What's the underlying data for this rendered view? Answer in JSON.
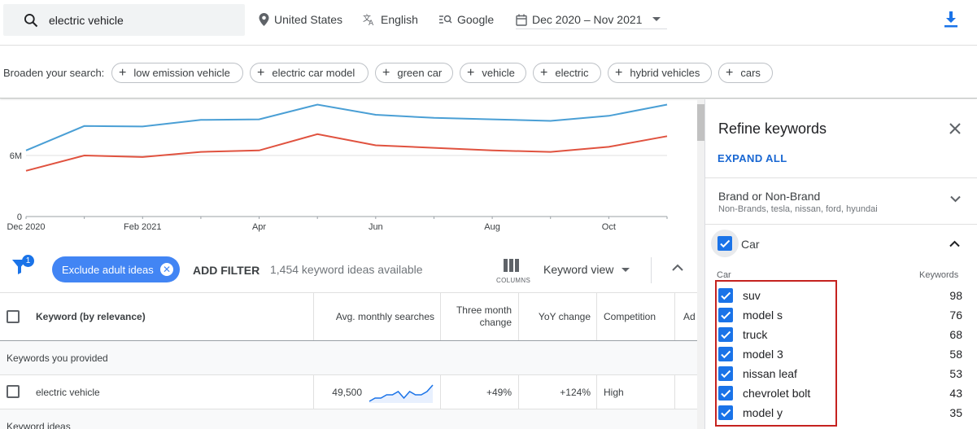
{
  "search": {
    "value": "electric vehicle"
  },
  "top": {
    "location": "United States",
    "language": "English",
    "network": "Google",
    "date_range": "Dec 2020 – Nov 2021"
  },
  "broaden": {
    "label": "Broaden your search:",
    "chips": [
      "low emission vehicle",
      "electric car model",
      "green car",
      "vehicle",
      "electric",
      "hybrid vehicles",
      "cars"
    ]
  },
  "chart_data": {
    "type": "line",
    "x": [
      "Dec 2020",
      "Jan 2021",
      "Feb 2021",
      "Mar 2021",
      "Apr 2021",
      "May 2021",
      "Jun 2021",
      "Jul 2021",
      "Aug 2021",
      "Sep 2021",
      "Oct 2021",
      "Nov 2021"
    ],
    "x_tick_labels": [
      "Dec 2020",
      "Feb 2021",
      "Apr",
      "Jun",
      "Aug",
      "Oct"
    ],
    "y_tick_labels": [
      "0",
      "6M"
    ],
    "ylim": [
      0,
      12000000
    ],
    "series": [
      {
        "color": "#4a9fd5",
        "values": [
          6500000,
          8900000,
          8850000,
          9500000,
          9550000,
          11000000,
          10000000,
          9700000,
          9550000,
          9400000,
          9900000,
          11000000
        ]
      },
      {
        "color": "#e0523f",
        "values": [
          4500000,
          6000000,
          5850000,
          6350000,
          6500000,
          8100000,
          7000000,
          6750000,
          6500000,
          6350000,
          6850000,
          7900000
        ]
      }
    ]
  },
  "filter": {
    "badge": "1",
    "exclude_chip": "Exclude adult ideas",
    "add_filter": "ADD FILTER",
    "ideas_count": "1,454 keyword ideas available",
    "columns_label": "COLUMNS",
    "keyword_view": "Keyword view"
  },
  "table": {
    "headers": {
      "keyword": "Keyword (by relevance)",
      "avg": "Avg. monthly searches",
      "three_month_1": "Three month",
      "three_month_2": "change",
      "yoy": "YoY change",
      "competition": "Competition",
      "ad": "Ad"
    },
    "group_provided": "Keywords you provided",
    "row": {
      "keyword": "electric vehicle",
      "avg": "49,500",
      "three_month": "+49%",
      "yoy": "+124%",
      "competition": "High",
      "sparkline": [
        3,
        4,
        4,
        5,
        5,
        6,
        4,
        6,
        5,
        5,
        6,
        8
      ]
    },
    "group_ideas": "Keyword ideas"
  },
  "panel": {
    "title": "Refine keywords",
    "expand_all": "EXPAND ALL",
    "brand": {
      "title": "Brand or Non-Brand",
      "subtitle": "Non-Brands, tesla, nissan, ford, hyundai"
    },
    "car": {
      "title": "Car",
      "col_left": "Car",
      "col_right": "Keywords",
      "items": [
        {
          "name": "suv",
          "count": "98"
        },
        {
          "name": "model s",
          "count": "76"
        },
        {
          "name": "truck",
          "count": "68"
        },
        {
          "name": "model 3",
          "count": "58"
        },
        {
          "name": "nissan leaf",
          "count": "53"
        },
        {
          "name": "chevrolet bolt",
          "count": "43"
        },
        {
          "name": "model y",
          "count": "35"
        }
      ]
    }
  },
  "colors": {
    "accent": "#1a73e8",
    "chip_blue": "#4285f4",
    "highlight_red": "#c5221f"
  }
}
